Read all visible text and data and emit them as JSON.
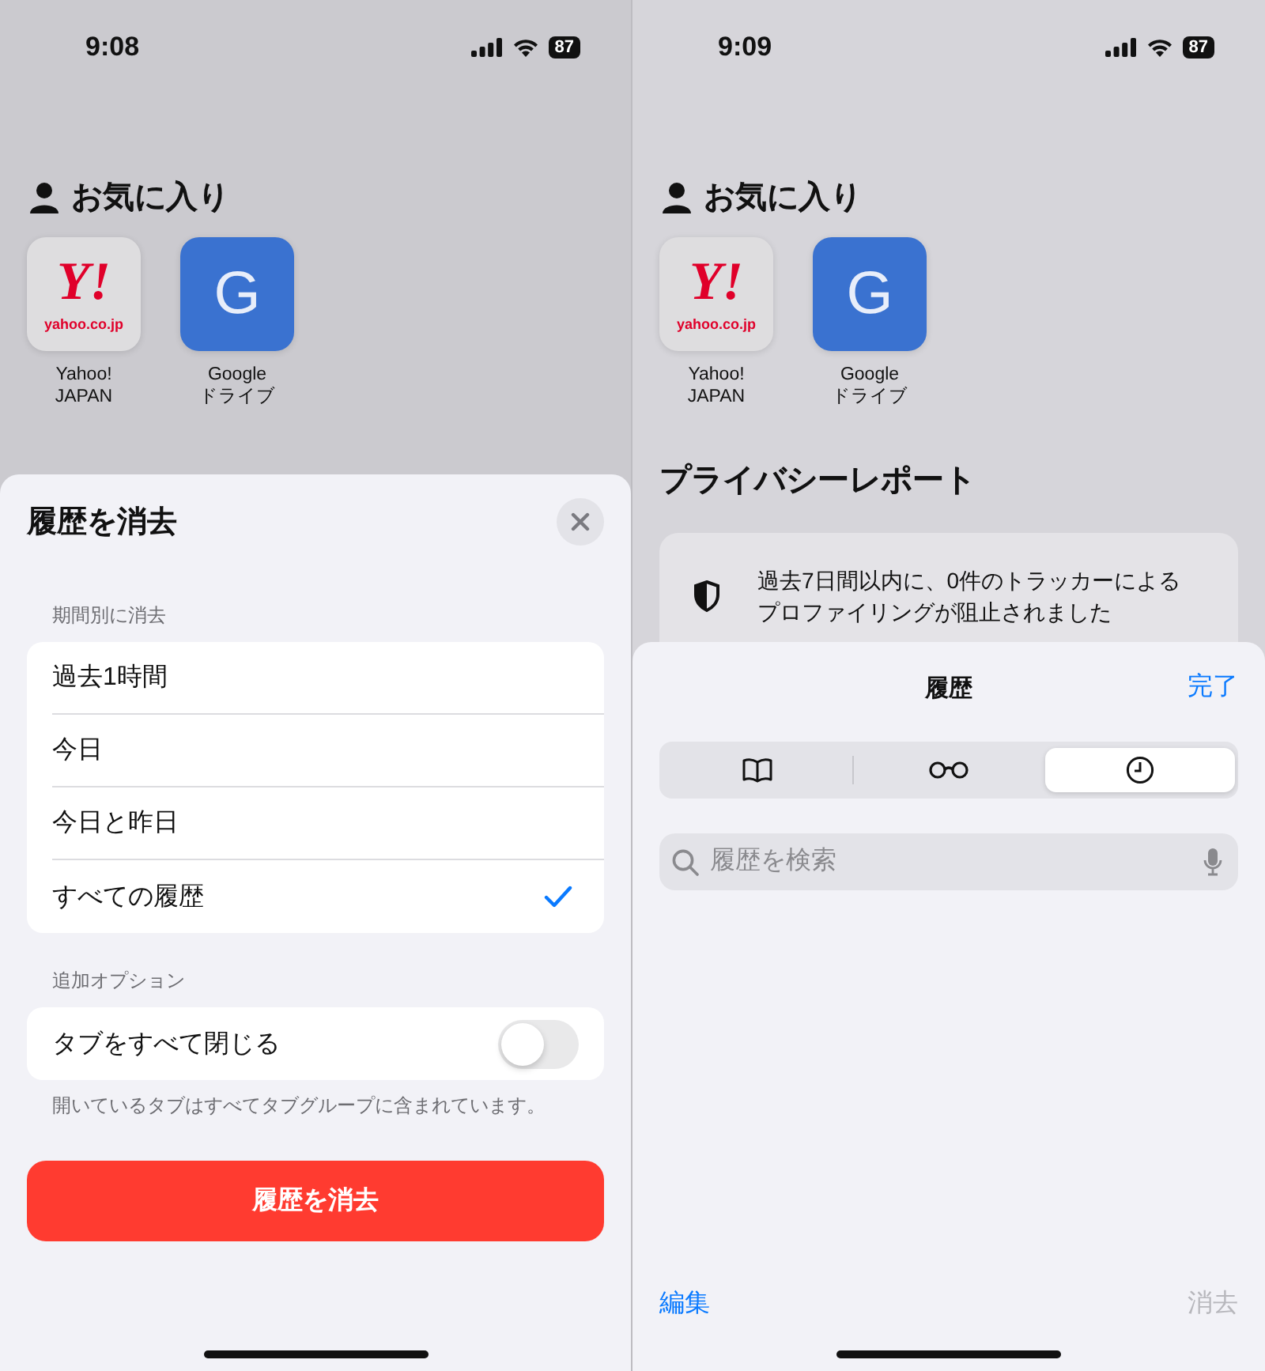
{
  "screens": [
    {
      "status_bar": {
        "time": "9:08",
        "battery": "87"
      },
      "favorites": {
        "title": "お気に入り",
        "items": [
          {
            "kind": "yahoo",
            "logo": "Y!",
            "domain": "yahoo.co.jp",
            "label_lines": [
              "Yahoo!",
              "JAPAN"
            ]
          },
          {
            "kind": "letter",
            "logo": "G",
            "label_lines": [
              "Google",
              "ドライブ"
            ]
          }
        ]
      },
      "sheet": {
        "kind": "clear_history",
        "title": "履歴を消去",
        "period_header": "期間別に消去",
        "periods": [
          {
            "label": "過去1時間",
            "selected": false
          },
          {
            "label": "今日",
            "selected": false
          },
          {
            "label": "今日と昨日",
            "selected": false
          },
          {
            "label": "すべての履歴",
            "selected": true
          }
        ],
        "options_header": "追加オプション",
        "options": [
          {
            "label": "タブをすべて閉じる",
            "on": false
          }
        ],
        "footnote": "開いているタブはすべてタブグループに含まれています。",
        "button": "履歴を消去"
      }
    },
    {
      "status_bar": {
        "time": "9:09",
        "battery": "87"
      },
      "favorites": {
        "title": "お気に入り",
        "items": [
          {
            "kind": "yahoo",
            "logo": "Y!",
            "domain": "yahoo.co.jp",
            "label_lines": [
              "Yahoo!",
              "JAPAN"
            ]
          },
          {
            "kind": "letter",
            "logo": "G",
            "label_lines": [
              "Google",
              "ドライブ"
            ]
          }
        ]
      },
      "privacy": {
        "title": "プライバシーレポート",
        "lines": [
          "過去7日間以内に、0件のトラッカーによる",
          "プロファイリングが阻止されました"
        ]
      },
      "sheet": {
        "kind": "history",
        "title": "履歴",
        "done": "完了",
        "segments": [
          {
            "kind": "bookmarks",
            "selected": false
          },
          {
            "kind": "reading_list",
            "selected": false
          },
          {
            "kind": "history",
            "selected": true
          }
        ],
        "search": {
          "placeholder": "履歴を検索"
        },
        "edit": "編集",
        "clear": {
          "label": "消去",
          "disabled": true
        }
      }
    }
  ]
}
